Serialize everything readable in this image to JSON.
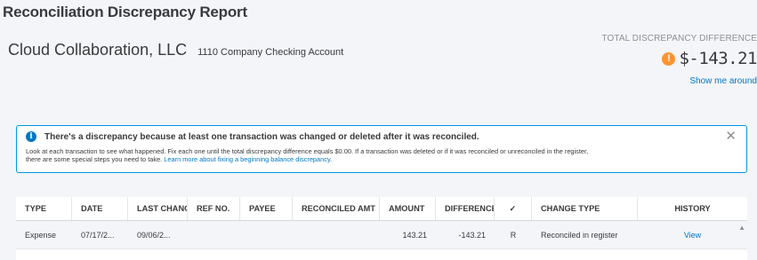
{
  "report_title": "Reconciliation Discrepancy Report",
  "company": {
    "name": "Cloud Collaboration, LLC",
    "account": "1110 Company Checking Account"
  },
  "discrepancy": {
    "label": "TOTAL DISCREPANCY DIFFERENCE",
    "value": "$-143.21",
    "warn_glyph": "!",
    "show_me_link": "Show me around"
  },
  "alert": {
    "info_glyph": "i",
    "title": "There's a discrepancy because at least one transaction was changed or deleted after it was reconciled.",
    "body_line1": "Look at each transaction to see what happened. Fix each one until the total discrepancy difference equals $0.00. If a transaction was deleted or if it was reconciled or unreconciled in the register,",
    "body_line2_text": "there are some special steps you need to take. ",
    "body_line2_link": "Learn more about fixing a beginning balance discrepancy.",
    "close_glyph": "✕"
  },
  "table": {
    "headers": {
      "type": "TYPE",
      "date": "DATE",
      "last_changed": "LAST CHANG",
      "ref_no": "REF NO.",
      "payee": "PAYEE",
      "reconciled_amt": "RECONCILED AMT",
      "amount": "AMOUNT",
      "difference": "DIFFERENCE",
      "check": "✓",
      "change_type": "CHANGE TYPE",
      "history": "HISTORY"
    },
    "rows": [
      {
        "type": "Expense",
        "date": "07/17/2...",
        "last_changed": "09/06/2...",
        "ref_no": "",
        "payee": "",
        "reconciled_amt": "",
        "amount": "143.21",
        "difference": "-143.21",
        "check": "R",
        "change_type": "Reconciled in register",
        "history": "View"
      }
    ]
  },
  "colors": {
    "accent_link": "#0077c5",
    "warning": "#ff9331",
    "alert_border": "#0097e6",
    "background": "#f4f5f8"
  }
}
